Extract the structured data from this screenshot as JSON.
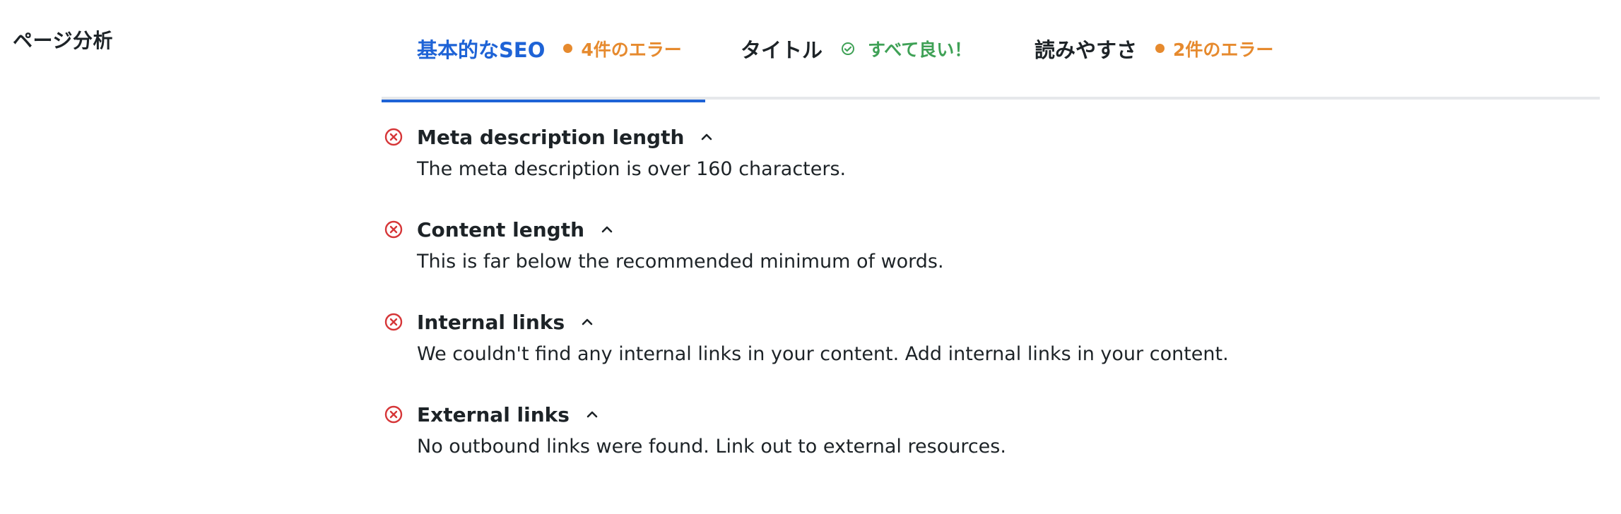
{
  "section": {
    "label": "ページ分析"
  },
  "tabs": [
    {
      "title": "基本的なSEO",
      "status": "4件のエラー",
      "state": "error",
      "active": true
    },
    {
      "title": "タイトル",
      "status": "すべて良い！",
      "state": "good",
      "active": false
    },
    {
      "title": "読みやすさ",
      "status": "2件のエラー",
      "state": "error",
      "active": false
    }
  ],
  "checks": [
    {
      "title": "Meta description length",
      "description": "The meta description is over 160 characters.",
      "icon": "x-circle-icon",
      "expanded": true
    },
    {
      "title": "Content length",
      "description": "This is far below the recommended minimum of words.",
      "icon": "x-circle-icon",
      "expanded": true
    },
    {
      "title": "Internal links",
      "description": "We couldn't find any internal links in your content. Add internal links in your content.",
      "icon": "x-circle-icon",
      "expanded": true
    },
    {
      "title": "External links",
      "description": "No outbound links were found. Link out to external resources.",
      "icon": "x-circle-icon",
      "expanded": true
    }
  ],
  "colors": {
    "accent": "#1e63d6",
    "error": "#d63638",
    "warning": "#e68a2e",
    "success": "#3fa156",
    "text": "#1d2327",
    "divider": "#e6e8eb"
  }
}
